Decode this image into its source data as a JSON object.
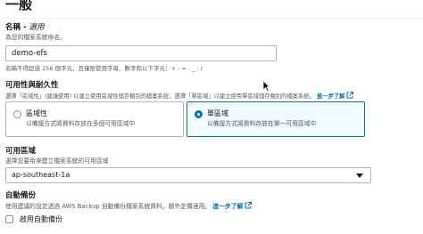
{
  "section": {
    "title": "一般"
  },
  "name_field": {
    "label": "名稱 - ",
    "optional": "選用",
    "description": "為您的檔案系統命名。",
    "value": "demo-efs",
    "constraint": "名稱不得超過 256 個字元，且僅限使用字母、數字和以下字元：+ - = . _ : /"
  },
  "availability": {
    "label": "可用性與耐久性",
    "description": "選擇「區域性」(建議使用) 以建立使用區域性儲存類別的檔案系統。選擇「單區域」以建立使用單區域儲存類別的檔案系統。",
    "learn_more": "進一步了解",
    "options": [
      {
        "title": "區域性",
        "description": "以備援方式將資料存放在多個可用區域中",
        "selected": false
      },
      {
        "title": "單區域",
        "description": "以備援方式將資料存放在單一可用區域中",
        "selected": true
      }
    ]
  },
  "az_field": {
    "label": "可用區域",
    "description": "選擇您要用來建立檔案系統的可用區域",
    "selected": "ap-southeast-1a"
  },
  "backup": {
    "label": "自動備份",
    "description": "使用建議的設定透過 AWS Backup 自動備份檔案系統資料。額外定價適用。",
    "learn_more": "進一步了解",
    "checkbox_label": "啟用自動備份",
    "checked": false
  },
  "colors": {
    "link": "#0073bb",
    "selected_border": "#0073bb",
    "selected_bg": "#f1faff"
  },
  "icons": {
    "external_link": "external-link-icon",
    "dropdown": "caret-down-icon",
    "pointer": "mouse-pointer-icon"
  }
}
